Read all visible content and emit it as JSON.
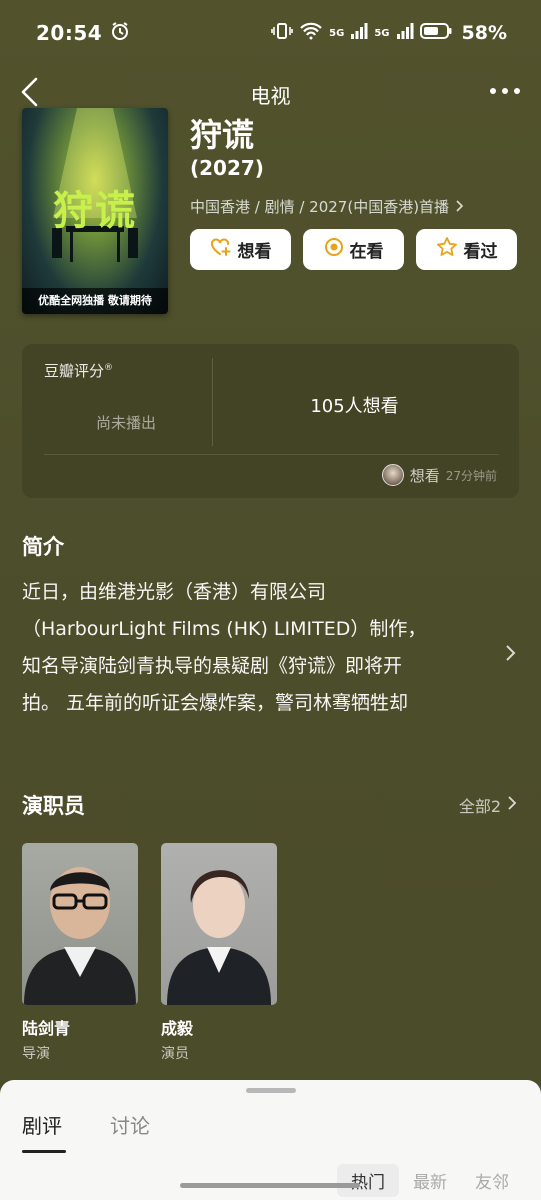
{
  "status_bar": {
    "time": "20:54",
    "network_a": "5G",
    "network_b": "5G",
    "battery": "58%"
  },
  "nav": {
    "title": "电视"
  },
  "poster": {
    "title": "狩谎",
    "banner": "优酷全网独播 敬请期待"
  },
  "show": {
    "title": "狩谎",
    "year": "(2027)",
    "meta": "中国香港 / 剧情 / 2027(中国香港)首播"
  },
  "actions": [
    {
      "label": "想看",
      "icon": "heart-plus-icon"
    },
    {
      "label": "在看",
      "icon": "target-icon"
    },
    {
      "label": "看过",
      "icon": "star-icon"
    }
  ],
  "rating": {
    "label": "豆瓣评分",
    "registered": "®",
    "status": "尚未播出",
    "wants": "105人想看",
    "activity_action": "想看",
    "activity_time": "27分钟前"
  },
  "intro": {
    "title": "简介",
    "lines": [
      "近日，由维港光影（香港）有限公司",
      "（HarbourLight Films (HK) LIMITED）制作，",
      "知名导演陆剑青执导的悬疑剧《狩谎》即将开",
      "拍。 五年前的听证会爆炸案，警司林骞牺牲却"
    ]
  },
  "cast": {
    "title": "演职员",
    "all_label": "全部2",
    "members": [
      {
        "name": "陆剑青",
        "role": "导演"
      },
      {
        "name": "成毅",
        "role": "演员"
      }
    ]
  },
  "sheet": {
    "tabs": [
      "剧评",
      "讨论"
    ],
    "sort": [
      "热门",
      "最新",
      "友邻"
    ],
    "ghost": "剧评     讨论"
  },
  "colors": {
    "background": "#4d4e2b",
    "accent": "#e8a317",
    "sheet": "#f7f7f5"
  }
}
